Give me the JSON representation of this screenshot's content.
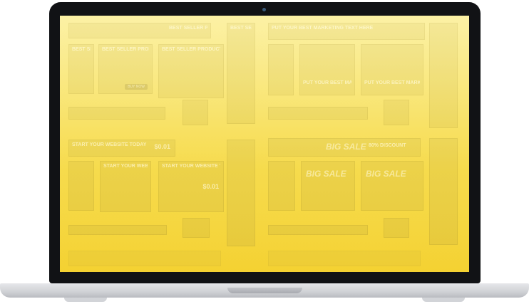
{
  "banners": {
    "best_seller": "BEST SELLER PRODUCT",
    "buy_now": "BUY NOW",
    "marketing": "PUT YOUR BEST MARKETING TEXT HERE",
    "website_today": "START YOUR WEBSITE TODAY",
    "price": "$0.01",
    "big_sale": "BIG SALE",
    "discount": "80% DISCOUNT"
  }
}
